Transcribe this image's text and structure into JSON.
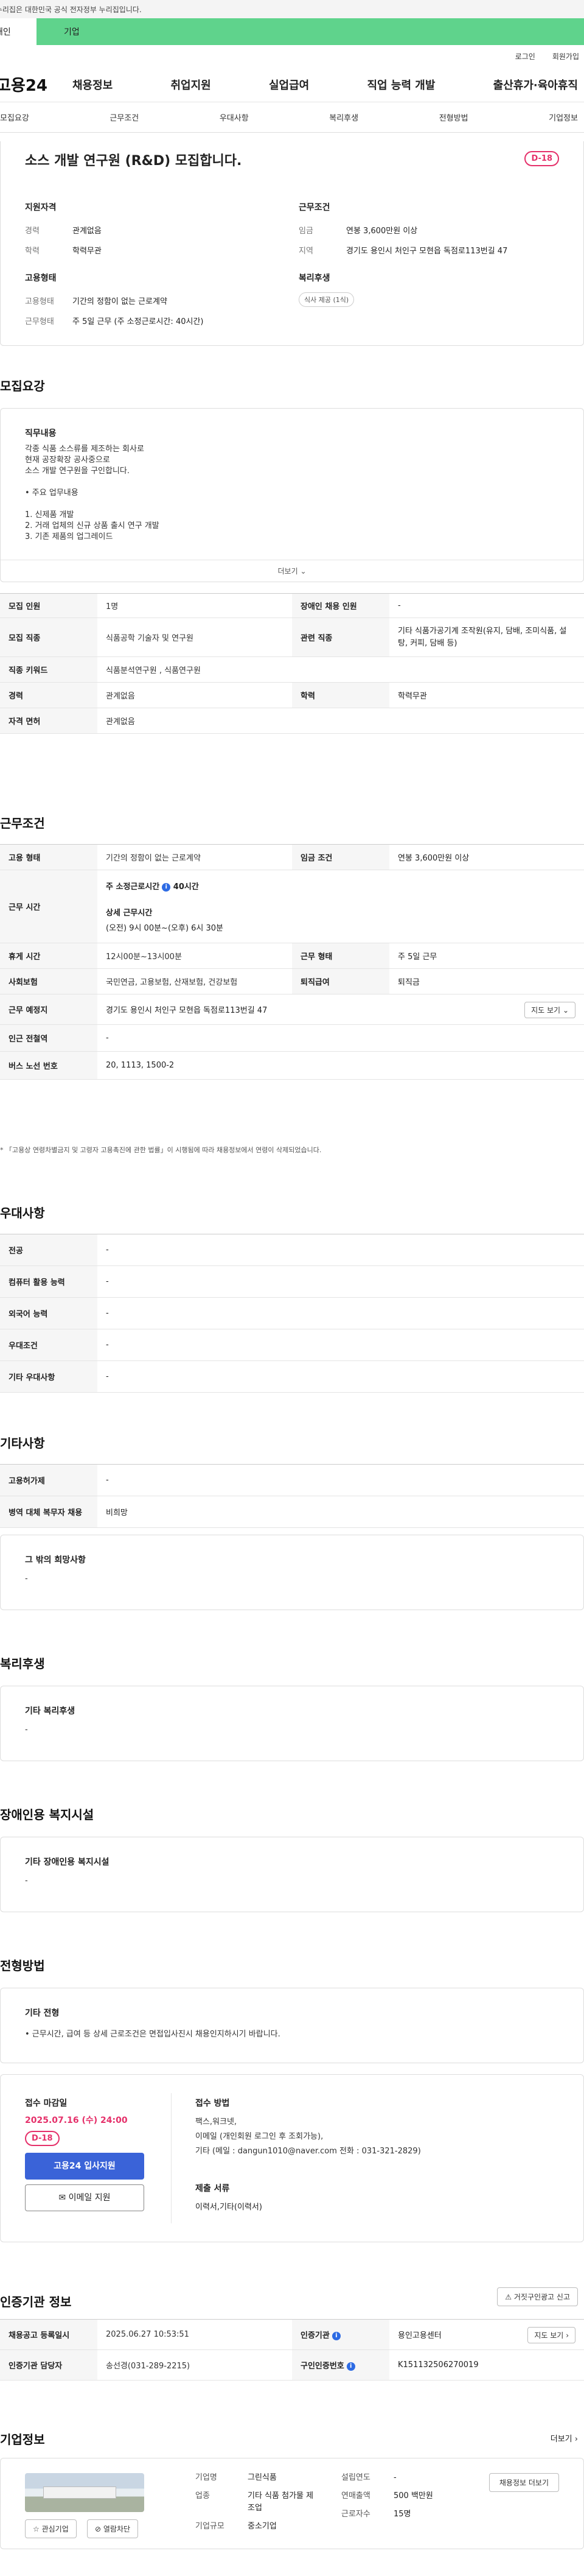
{
  "gov_banner": "이 누리집은 대한민국 공식 전자정부 누리집입니다.",
  "user_tabs": [
    "개인",
    "기업"
  ],
  "util": [
    "로그인",
    "회원가입"
  ],
  "logo": "고용24",
  "gnb": [
    "채용정보",
    "취업지원",
    "실업급여",
    "직업 능력 개발",
    "출산휴가·육아휴직"
  ],
  "subnav": [
    "모집요강",
    "근무조건",
    "우대사항",
    "복리후생",
    "전형방법",
    "기업정보"
  ],
  "summary": {
    "title": "소스 개발 연구원 (R&D) 모집합니다.",
    "dday": "D-18",
    "qual_h": "지원자격",
    "career_k": "경력",
    "career_v": "관계없음",
    "edu_k": "학력",
    "edu_v": "학력무관",
    "cond_h": "근무조건",
    "wage_k": "임금",
    "wage_v": "연봉 3,600만원 이상",
    "loc_k": "지역",
    "loc_v": "경기도 용인시 처인구 모현읍 독점로113번길 47",
    "emp_h": "고용형태",
    "emptype_k": "고용형태",
    "emptype_v": "기간의 정함이 없는 근로계약",
    "hours_k": "근무형태",
    "hours_v": "주 5일 근무 (주 소정근로시간: 40시간)",
    "welfare_h": "복리후생",
    "welfare_tag": "식사 제공 (1식)"
  },
  "recruit": {
    "title": "모집요강",
    "job_h": "직무내용",
    "job_lines": [
      "각종 식품 소스류를 제조하는 회사로",
      "현재 공장확장 공사중으로",
      "소스 개발 연구원을 구인합니다.",
      "",
      "• 주요 업무내용",
      "",
      "1. 신제품 개발",
      "2. 거래 업체의 신규 상품 출시 연구 개발",
      "3. 기존 제품의 업그레이드"
    ],
    "more": "더보기",
    "rows": [
      [
        "모집 인원",
        "1명",
        "장애인 채용 인원",
        "-"
      ],
      [
        "모집 직종",
        "식품공학 기술자 및 연구원",
        "관련 직종",
        "기타 식품가공기계 조작원(유지, 담배, 조미식품, 설탕, 커피, 담배 등)"
      ],
      [
        "직종 키워드",
        "식품분석연구원 , 식품연구원",
        "",
        ""
      ],
      [
        "경력",
        "관계없음",
        "학력",
        "학력무관"
      ],
      [
        "자격 면허",
        "관계없음",
        "",
        ""
      ]
    ]
  },
  "work": {
    "title": "근무조건",
    "r1": [
      "고용 형태",
      "기간의 정함이 없는 근로계약",
      "임금 조건",
      "연봉 3,600만원 이상"
    ],
    "hours_k": "근무 시간",
    "weekly": "주 소정근로시간",
    "weekly_v": "40시간",
    "detail_h": "상세 근무시간",
    "detail_v": "(오전) 9시 00분~(오후) 6시 30분",
    "r3": [
      "휴게 시간",
      "12시00분~13시00분",
      "근무 형태",
      "주 5일 근무"
    ],
    "r4": [
      "사회보험",
      "국민연금, 고용보험, 산재보험, 건강보험",
      "퇴직급여",
      "퇴직금"
    ],
    "loc_k": "근무 예정지",
    "loc_v": "경기도 용인시 처인구 모현읍 독점로113번길 47",
    "map_btn": "지도 보기",
    "subway_k": "인근 전철역",
    "subway_v": "-",
    "bus_k": "버스 노선 번호",
    "bus_v": "20, 1113, 1500-2",
    "notice": "* 「고용상 연령차별금지 및 고령자 고용촉진에 관한 법률」이 시행됨에 따라 채용정보에서 연령이 삭제되었습니다."
  },
  "pref": {
    "title": "우대사항",
    "rows": [
      [
        "전공",
        "-"
      ],
      [
        "컴퓨터 활용 능력",
        "-"
      ],
      [
        "외국어 능력",
        "-"
      ],
      [
        "우대조건",
        "-"
      ],
      [
        "기타 우대사항",
        "-"
      ]
    ]
  },
  "etc": {
    "title": "기타사항",
    "rows": [
      [
        "고용허가제",
        "-"
      ],
      [
        "병역 대체 복무자 채용",
        "비희망"
      ]
    ],
    "box_h": "그 밖의 희망사항",
    "box_v": "-"
  },
  "welfare": {
    "title": "복리후생",
    "box_h": "기타 복리후생",
    "box_v": "-"
  },
  "disab": {
    "title": "장애인용 복지시설",
    "box_h": "기타 장애인용 복지시설",
    "box_v": "-"
  },
  "process": {
    "title": "전형방법",
    "box_h": "기타 전형",
    "box_v": "• 근무시간, 급여 등 상세 근로조건은 면접입사진시 채용인지하시기 바랍니다."
  },
  "apply": {
    "deadline_h": "접수 마감일",
    "deadline_v": "2025.07.16 (수) 24:00",
    "dday": "D-18",
    "apply_btn": "고용24 입사지원",
    "email_btn": "이메일 지원",
    "method_h": "접수 방법",
    "method_lines": [
      "팩스,워크넷,",
      "이메일 (개인회원 로그인 후 조회가능),",
      "기타 (메일 : dangun1010@naver.com 전화 : 031-321-2829)"
    ],
    "docs_h": "제출 서류",
    "docs_v": "이력서,기타(이력서)"
  },
  "cert": {
    "title": "인증기관 정보",
    "report_btn": "거짓구인광고 신고",
    "r1": [
      "채용공고 등록일시",
      "2025.06.27 10:53:51",
      "인증기관",
      "용인고용센터"
    ],
    "map_btn": "지도 보기",
    "r2": [
      "인증기관 담당자",
      "송선경(031-289-2215)",
      "구인인증번호",
      "K151132506270019"
    ]
  },
  "company": {
    "title": "기업정보",
    "more": "더보기",
    "fav_btn": "관심기업",
    "block_btn": "열람차단",
    "industry_k": "업종",
    "industry_v": "기타 식품 첨가물 제조업",
    "name_k": "기업명",
    "name_v": "그린식품",
    "size_k": "기업규모",
    "size_v": "중소기업",
    "founded_k": "설립연도",
    "founded_v": "-",
    "sales_k": "연매출액",
    "sales_v": "500 백만원",
    "staff_k": "근로자수",
    "staff_v": "15명",
    "recruit_btn": "채용정보 더보기"
  }
}
